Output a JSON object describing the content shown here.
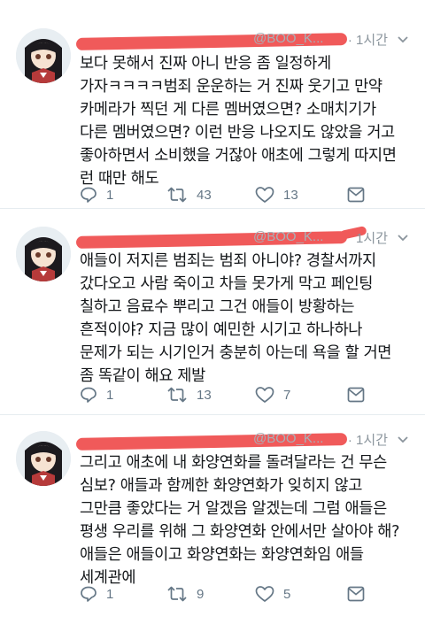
{
  "tweets": [
    {
      "handle": "@BOO_K...",
      "time": "· 1시간",
      "lines": [
        "보다 못해서 진짜 아니 반응 좀 일정하게",
        "가자ㅋㅋㅋㅋ범죄 운운하는 거 진짜 웃기고 만약",
        "카메라가 찍던 게 다른 멤버였으면? 소매치기가",
        "다른 멤버였으면? 이런 반응 나오지도 않았을 거고",
        "좋아하면서 소비했을 거잖아 애초에 그렇게 따지면",
        "런 때만 해도"
      ],
      "reply_count": "1",
      "retweet_count": "43",
      "like_count": "13"
    },
    {
      "handle": "@BOO_K...",
      "time": "1시간",
      "lines": [
        "애들이 저지른 범죄는 범죄 아니야? 경찰서까지",
        "갔다오고 사람 죽이고 차들 못가게 막고 페인팅",
        "칠하고 음료수 뿌리고 그건 애들이 방황하는",
        "흔적이야? 지금 많이 예민한 시기고 하나하나",
        "문제가 되는 시기인거 충분히 아는데 욕을 할 거면",
        "좀 똑같이 해요 제발"
      ],
      "reply_count": "1",
      "retweet_count": "13",
      "like_count": "7"
    },
    {
      "handle": "@BOO_K...",
      "time": "· 1시간",
      "lines": [
        "그리고 애초에 내 화양연화를 돌려달라는 건 무슨",
        "심보? 애들과 함께한 화양연화가 잊히지 않고",
        "그만큼 좋았다는 거 알겠음 알겠는데 그럼 애들은",
        "평생 우리를 위해 그 화양연화 안에서만 살아야 해?",
        "애들은 애들이고 화양연화는 화양연화임 애들",
        "세계관에"
      ],
      "reply_count": "1",
      "retweet_count": "9",
      "like_count": "5"
    }
  ],
  "colors": {
    "text": "#14171a",
    "meta": "#657786",
    "redact": "#f05a5a",
    "divider": "#e6ecf0"
  },
  "icons": [
    "avatar-icon",
    "chevron-down-icon",
    "reply-icon",
    "retweet-icon",
    "like-icon",
    "dm-icon"
  ]
}
